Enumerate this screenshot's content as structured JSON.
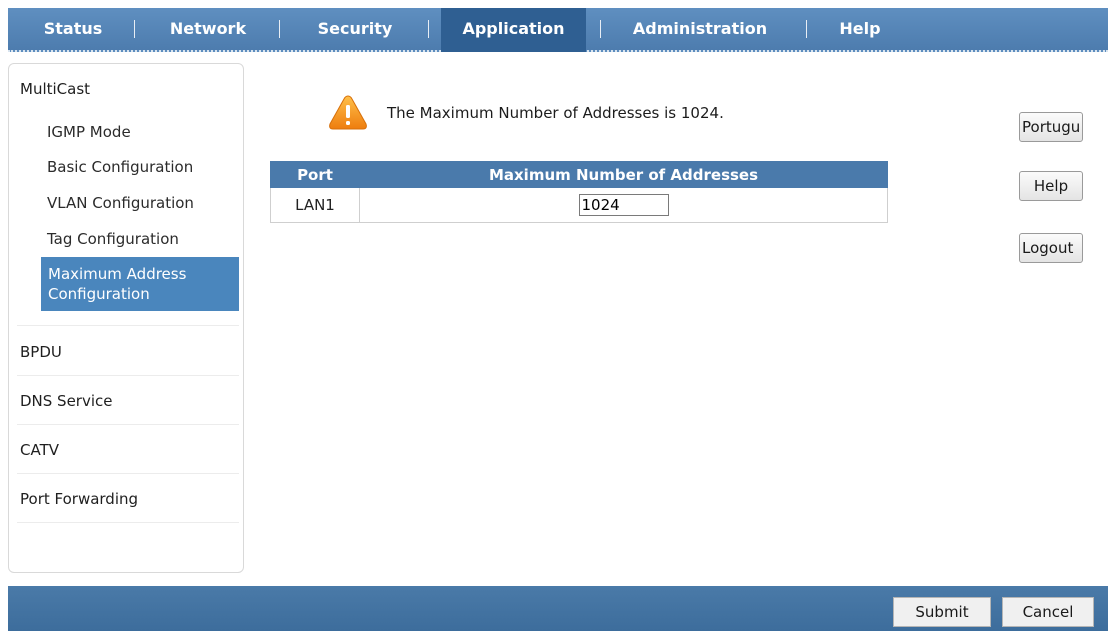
{
  "nav": {
    "items": [
      {
        "label": "Status"
      },
      {
        "label": "Network"
      },
      {
        "label": "Security"
      },
      {
        "label": "Application",
        "active": true
      },
      {
        "label": "Administration"
      },
      {
        "label": "Help"
      }
    ]
  },
  "sidebar": {
    "multicast": {
      "label": "MultiCast",
      "items": [
        {
          "label": "IGMP Mode"
        },
        {
          "label": "Basic Configuration"
        },
        {
          "label": "VLAN Configuration"
        },
        {
          "label": "Tag Configuration"
        },
        {
          "label_line1": "Maximum Address",
          "label_line2": "Configuration",
          "active": true
        }
      ]
    },
    "groups": [
      {
        "label": "BPDU"
      },
      {
        "label": "DNS Service"
      },
      {
        "label": "CATV"
      },
      {
        "label": "Port Forwarding"
      }
    ]
  },
  "main": {
    "notice": "The Maximum Number of Addresses is 1024.",
    "notice_icon": "warning-icon",
    "table": {
      "headers": [
        "Port",
        "Maximum Number of Addresses"
      ],
      "rows": [
        {
          "port": "LAN1",
          "max_addresses": "1024"
        }
      ]
    }
  },
  "right_buttons": {
    "language": "Portugu",
    "help": "Help",
    "logout": "Logout"
  },
  "footer": {
    "submit": "Submit",
    "cancel": "Cancel"
  },
  "colors": {
    "nav_bg": "#5584b5",
    "nav_active": "#2f5f92",
    "sidebar_active": "#4a86bd",
    "table_header": "#4a7aab",
    "warning": "#f39a1e"
  }
}
